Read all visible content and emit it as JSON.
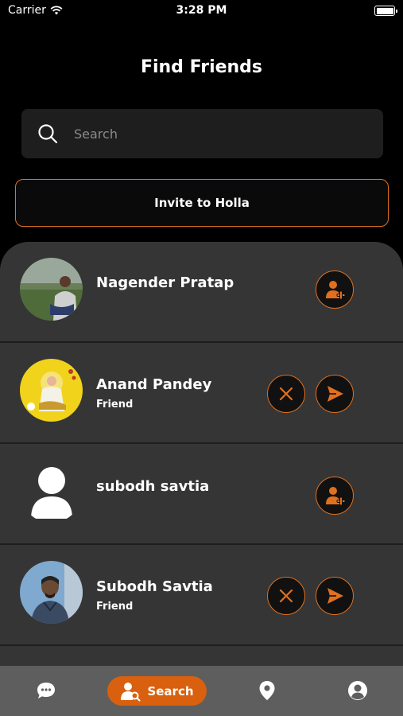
{
  "status_bar": {
    "carrier": "Carrier",
    "time": "3:28 PM"
  },
  "header": {
    "title": "Find Friends"
  },
  "search": {
    "placeholder": "Search"
  },
  "invite": {
    "label": "Invite to Holla"
  },
  "friends": [
    {
      "name": "Nagender Pratap",
      "subtitle": "",
      "is_friend": false,
      "avatar": "photo-outdoor"
    },
    {
      "name": "Anand Pandey",
      "subtitle": "Friend",
      "is_friend": true,
      "avatar": "photo-goddess-painting"
    },
    {
      "name": "subodh savtia",
      "subtitle": "",
      "is_friend": false,
      "avatar": "default-user-silhouette"
    },
    {
      "name": "Subodh Savtia",
      "subtitle": "Friend",
      "is_friend": true,
      "avatar": "photo-portrait"
    }
  ],
  "tabs": [
    {
      "icon": "chat-bubble-icon"
    },
    {
      "icon": "search-user-icon",
      "label": "Search",
      "active": true
    },
    {
      "icon": "location-pin-icon"
    },
    {
      "icon": "profile-icon"
    }
  ],
  "colors": {
    "accent": "#e07020",
    "background": "#000000",
    "sheet": "#353535",
    "tabbar": "#5e5e5e"
  }
}
